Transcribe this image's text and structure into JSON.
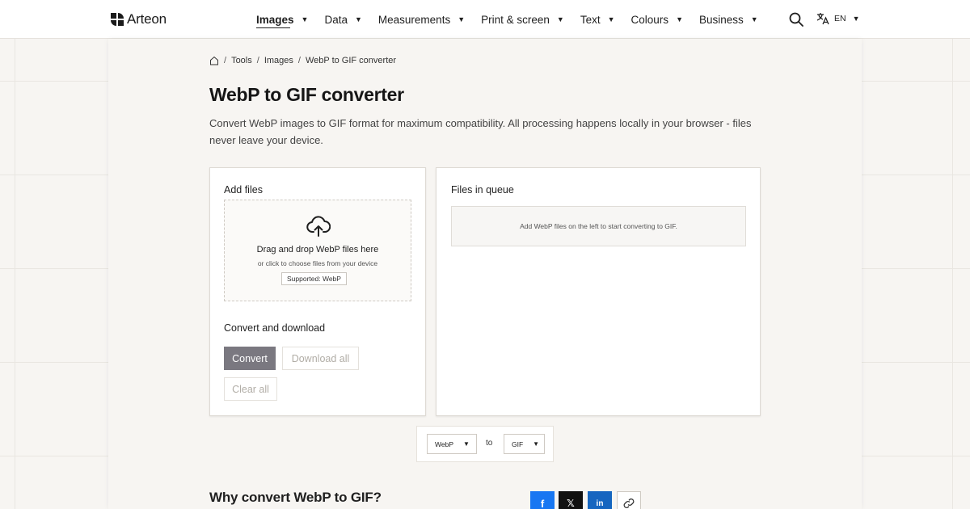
{
  "brand": {
    "name": "Arteon"
  },
  "nav": {
    "items": [
      {
        "label": "Images",
        "active": true
      },
      {
        "label": "Data"
      },
      {
        "label": "Measurements"
      },
      {
        "label": "Print & screen"
      },
      {
        "label": "Text"
      },
      {
        "label": "Colours"
      },
      {
        "label": "Business"
      }
    ],
    "language": "EN",
    "caret": "▼"
  },
  "breadcrumb": {
    "items": [
      "Tools",
      "Images",
      "WebP to GIF converter"
    ],
    "sep": "/"
  },
  "page": {
    "title": "WebP to GIF converter",
    "description": "Convert WebP images to GIF format for maximum compatibility. All processing happens locally in your browser - files never leave your device."
  },
  "add_files": {
    "heading": "Add files",
    "drop_main": "Drag and drop WebP files here",
    "drop_sub": "or click to choose files from your device",
    "supported": "Supported: WebP"
  },
  "convert_section": {
    "heading": "Convert and download",
    "convert_label": "Convert",
    "download_label": "Download all",
    "clear_label": "Clear all"
  },
  "queue": {
    "heading": "Files in queue",
    "empty_text": "Add WebP files on the left to start converting to GIF."
  },
  "format": {
    "from": "WebP",
    "connector": "to",
    "to": "GIF"
  },
  "why": {
    "heading": "Why convert WebP to GIF?"
  },
  "share": {
    "facebook": "f",
    "x": "𝕏",
    "linkedin": "in"
  },
  "colors": {
    "accent_button": "#7a7880",
    "facebook": "#1877f2",
    "linkedin": "#1666c0",
    "x": "#111111"
  }
}
